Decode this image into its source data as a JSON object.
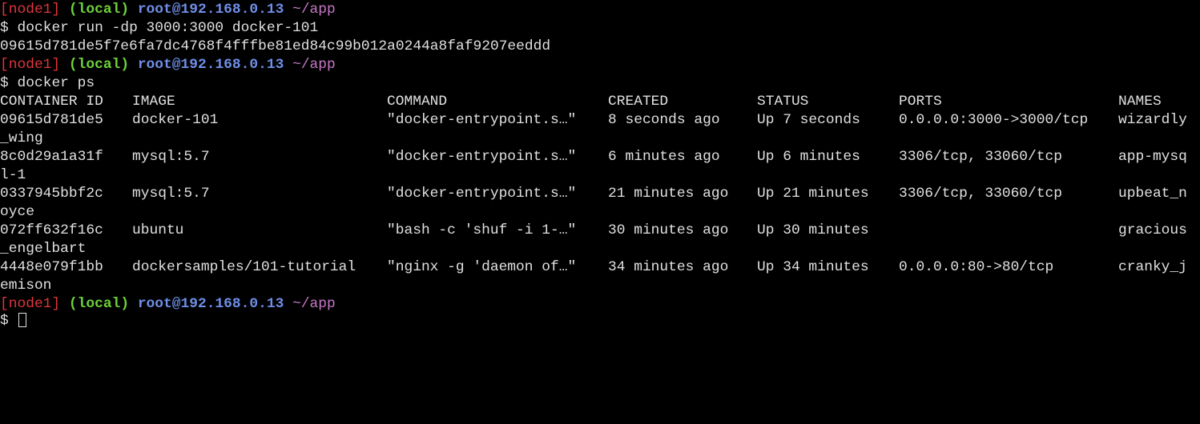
{
  "prompt": {
    "node": "[node1]",
    "local": "(local)",
    "host": "root@192.168.0.13",
    "path": "~/app",
    "symbol": "$"
  },
  "commands": {
    "run": "docker run -dp 3000:3000 docker-101",
    "container_hash": "09615d781de5f7e6fa7dc4768f4fffbe81ed84c99b012a0244a8faf9207eeddd",
    "ps": "docker ps"
  },
  "table": {
    "headers": {
      "container_id": "CONTAINER ID",
      "image": "IMAGE",
      "command": "COMMAND",
      "created": "CREATED",
      "status": "STATUS",
      "ports": "PORTS",
      "names": "NAMES"
    },
    "rows": [
      {
        "container_id": "09615d781de5",
        "image": "docker-101",
        "command": "\"docker-entrypoint.s…\"",
        "created": "8 seconds ago",
        "status": "Up 7 seconds",
        "ports": "0.0.0.0:3000->3000/tcp",
        "names_part1": "wizardly",
        "names_part2": "_wing"
      },
      {
        "container_id": "8c0d29a1a31f",
        "image": "mysql:5.7",
        "command": "\"docker-entrypoint.s…\"",
        "created": "6 minutes ago",
        "status": "Up 6 minutes",
        "ports": "3306/tcp, 33060/tcp",
        "names_part1": "app-mysq",
        "names_part2": "l-1"
      },
      {
        "container_id": "0337945bbf2c",
        "image": "mysql:5.7",
        "command": "\"docker-entrypoint.s…\"",
        "created": "21 minutes ago",
        "status": "Up 21 minutes",
        "ports": "3306/tcp, 33060/tcp",
        "names_part1": "upbeat_n",
        "names_part2": "oyce"
      },
      {
        "container_id": "072ff632f16c",
        "image": "ubuntu",
        "command": "\"bash -c 'shuf -i 1-…\"",
        "created": "30 minutes ago",
        "status": "Up 30 minutes",
        "ports": "",
        "names_part1": "gracious",
        "names_part2": "_engelbart"
      },
      {
        "container_id": "4448e079f1bb",
        "image": "dockersamples/101-tutorial",
        "command": "\"nginx -g 'daemon of…\"",
        "created": "34 minutes ago",
        "status": "Up 34 minutes",
        "ports": "0.0.0.0:80->80/tcp",
        "names_part1": "cranky_j",
        "names_part2": "emison"
      }
    ]
  },
  "colors": {
    "background": "#000000",
    "text": "#e0e0e0",
    "node": "#e0363b",
    "local": "#6cd23a",
    "host": "#6f8fe8",
    "path": "#c778c7"
  }
}
